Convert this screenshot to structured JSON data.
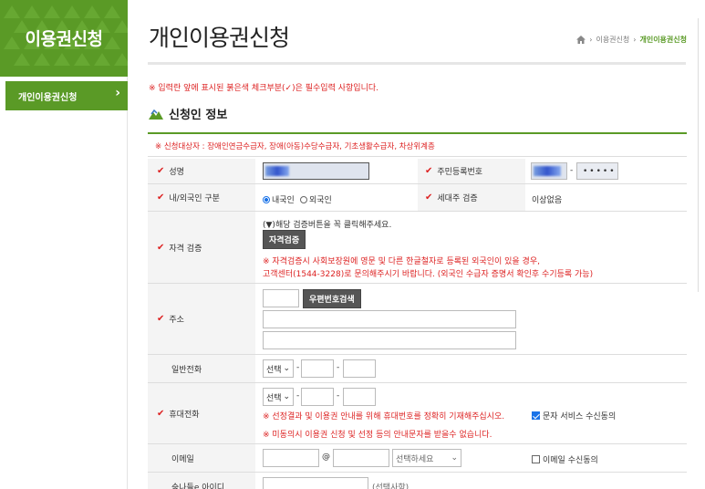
{
  "sidebar": {
    "title": "이용권신청",
    "items": [
      {
        "label": "개인이용권신청"
      }
    ]
  },
  "header": {
    "title": "개인이용권신청",
    "breadcrumb": [
      "이용권신청",
      "개인이용권신청"
    ]
  },
  "notice": "※ 입력란 앞에 표시된 붉은색 체크부분(✓)은 필수입력 사항입니다.",
  "section_title": "신청인 정보",
  "form": {
    "target_note": "※ 신청대상자 : 장애인연금수급자, 장애(아동)수당수급자, 기초생활수급자, 차상위계층",
    "name_label": "성명",
    "rrn_label": "주민등록번호",
    "rrn_masked": "•••••",
    "rrn_dash": "-",
    "nationality_label": "내/외국인 구분",
    "nationality_options": [
      "내국인",
      "외국인"
    ],
    "household_label": "세대주 검증",
    "household_value": "이상없음",
    "qual_label": "자격 검증",
    "qual_hint": "(▼)해당 검증버튼을 꼭 클릭해주세요.",
    "qual_button": "자격검증",
    "qual_note1": "※ 자격검증시 사회보장원에 영문 및 다른 한글철자로 등록된 외국인이 있을 경우,",
    "qual_note2": "고객센터(1544-3228)로 문의해주시기 바랍니다. (외국인 수급자 증명서 확인후 수기등록 가능)",
    "address_label": "주소",
    "zip_button": "우편번호검색",
    "phone_label": "일반전화",
    "select_placeholder": "선택",
    "dash": "-",
    "mobile_label": "휴대전화",
    "mobile_note1": "※ 선정결과 및 이용권 안내를 위해 휴대번호를 정확히 기재해주십시오.",
    "mobile_note2": "※ 미동의시 이용권 신청 및 선정 등의 안내문자를 받을수 없습니다.",
    "sms_consent": "문자 서비스 수신동의",
    "email_label": "이메일",
    "email_at": "@",
    "email_domain_placeholder": "선택하세요",
    "email_consent": "이메일 수신동의",
    "id_label": "숲나들e 아이디",
    "id_optional": "(선택사항)"
  },
  "colors": {
    "brand_green": "#5a9a26",
    "required_red": "#dd2222"
  }
}
